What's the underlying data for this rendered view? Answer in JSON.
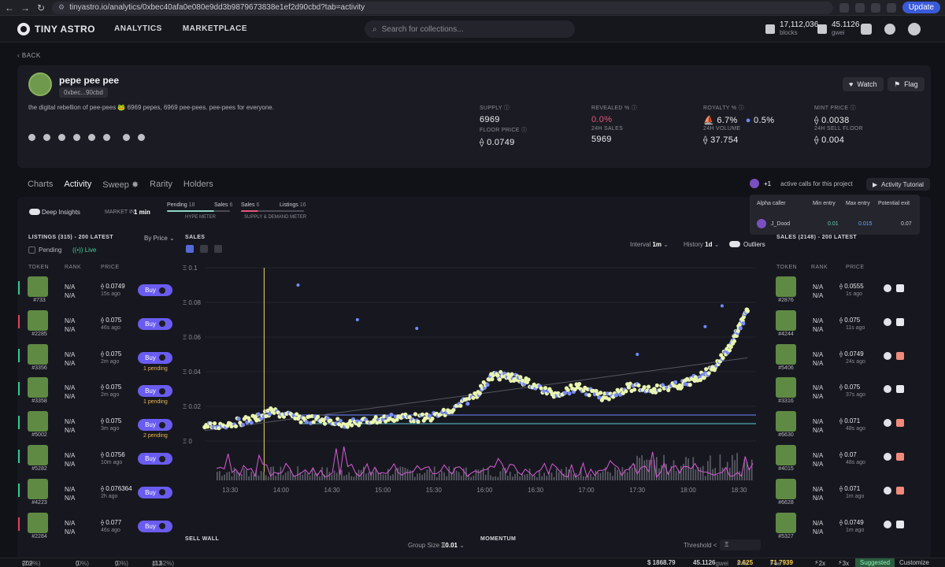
{
  "browser": {
    "url": "tinyastro.io/analytics/0xbec40afa0e080e9dd3b9879673838e1ef2d90cbd?tab=activity",
    "update_label": "Update"
  },
  "header": {
    "brand": "TINY ASTRO",
    "nav": [
      "ANALYTICS",
      "MARKETPLACE"
    ],
    "search_placeholder": "Search for collections...",
    "blocks_value": "17,112,036",
    "blocks_label": "blocks",
    "gas_value": "45.1126",
    "gas_label": "gwei"
  },
  "back_label": "‹ BACK",
  "project": {
    "name": "pepe pee pee",
    "address": "0xbec...90cbd",
    "description": "the digital rebellion of pee-pees 🐸 6969 pepes, 6969 pee-pees. pee-pees for everyone.",
    "watch_label": "Watch",
    "flag_label": "Flag",
    "stats": {
      "supply_label": "SUPPLY",
      "supply": "6969",
      "revealed_label": "REVEALED %",
      "revealed": "0.0%",
      "royalty_label": "ROYALTY %",
      "royalty_a": "6.7%",
      "royalty_b": "0.5%",
      "mint_label": "MINT PRICE",
      "mint": "0.0038",
      "floor_label": "FLOOR PRICE",
      "floor": "0.0749",
      "sales24_label": "24H SALES",
      "sales24": "5969",
      "volume24_label": "24H VOLUME",
      "volume24": "37.754",
      "sellfloor_label": "24H SELL FLOOR",
      "sellfloor": "0.004"
    }
  },
  "tabs": [
    "Charts",
    "Activity",
    "Sweep ✸",
    "Rarity",
    "Holders"
  ],
  "calls": {
    "count": "+1",
    "text": "active calls for this project",
    "tutorial": "Activity Tutorial"
  },
  "alpha": {
    "headers": [
      "Alpha caller",
      "Min entry",
      "Max entry",
      "Potential exit"
    ],
    "row": {
      "caller": "J_Dood",
      "min": "0.01",
      "max": "0.015",
      "exit": "0.07"
    }
  },
  "insights": {
    "deep_label": "Deep Insights",
    "market_label": "MARKET IN",
    "market_value": "1 min",
    "pending_label": "Pending",
    "pending_value": "18",
    "sales_label": "Sales",
    "sales_value": "6",
    "hype_label": "HYPE METER",
    "sd_sales_label": "Sales",
    "sd_sales_value": "6",
    "listings_label": "Listings",
    "listings_value": "16",
    "sd_label": "SUPPLY & DEMAND METER"
  },
  "listings": {
    "title": "LISTINGS (315) - 200 LATEST",
    "sort": "By Price",
    "pending_label": "Pending",
    "live_label": "Live",
    "columns": [
      "TOKEN",
      "RANK",
      "PRICE"
    ],
    "buy_label": "Buy",
    "rows": [
      {
        "id": "#733",
        "rank": "N/A",
        "rank2": "N/A",
        "price": "0.0749",
        "ago": "15s ago",
        "pending": "",
        "bar": "#2ecc8f"
      },
      {
        "id": "#2285",
        "rank": "N/A",
        "rank2": "N/A",
        "price": "0.075",
        "ago": "46s ago",
        "pending": "",
        "bar": "#e0425c"
      },
      {
        "id": "#3356",
        "rank": "N/A",
        "rank2": "N/A",
        "price": "0.075",
        "ago": "2m ago",
        "pending": "1 pending",
        "bar": "#2ecc8f"
      },
      {
        "id": "#3358",
        "rank": "N/A",
        "rank2": "N/A",
        "price": "0.075",
        "ago": "2m ago",
        "pending": "1 pending",
        "bar": "#2ecc8f"
      },
      {
        "id": "#5002",
        "rank": "N/A",
        "rank2": "N/A",
        "price": "0.075",
        "ago": "3m ago",
        "pending": "2 pending",
        "bar": "#2ecc8f"
      },
      {
        "id": "#5282",
        "rank": "N/A",
        "rank2": "N/A",
        "price": "0.0756",
        "ago": "10m ago",
        "pending": "",
        "bar": "#2ecc8f"
      },
      {
        "id": "#4223",
        "rank": "N/A",
        "rank2": "N/A",
        "price": "0.076364",
        "ago": "2h ago",
        "pending": "",
        "bar": "#2ecc8f"
      },
      {
        "id": "#2284",
        "rank": "N/A",
        "rank2": "N/A",
        "price": "0.077",
        "ago": "46s ago",
        "pending": "",
        "bar": "#e0425c"
      }
    ]
  },
  "sales_chart": {
    "title": "SALES",
    "interval_label": "Interval",
    "interval": "1m",
    "history_label": "History",
    "history": "1d",
    "outliers_label": "Outliers"
  },
  "chart_data": {
    "type": "scatter",
    "y_ticks": [
      "Ξ 0.1",
      "Ξ 0.08",
      "Ξ 0.06",
      "Ξ 0.04",
      "Ξ 0.02",
      "Ξ 0"
    ],
    "x_ticks": [
      "13:30",
      "14:00",
      "14:30",
      "15:00",
      "15:30",
      "16:00",
      "16:30",
      "17:00",
      "17:30",
      "18:00",
      "18:30"
    ],
    "ylim": [
      0,
      0.1
    ],
    "series": [
      {
        "values_time": [
          "13:15",
          "13:30",
          "13:45",
          "13:55",
          "14:10",
          "14:25",
          "14:40",
          "14:55",
          "15:10",
          "15:25",
          "15:40",
          "15:55",
          "16:05",
          "16:15",
          "16:25",
          "16:40",
          "16:55",
          "17:10",
          "17:25",
          "17:40",
          "17:55",
          "18:05",
          "18:15",
          "18:25",
          "18:30",
          "18:35"
        ],
        "values": [
          0.008,
          0.01,
          0.013,
          0.017,
          0.013,
          0.012,
          0.01,
          0.012,
          0.014,
          0.013,
          0.017,
          0.027,
          0.038,
          0.037,
          0.034,
          0.027,
          0.031,
          0.025,
          0.031,
          0.03,
          0.032,
          0.036,
          0.042,
          0.055,
          0.065,
          0.075
        ]
      }
    ],
    "overlay_lines": [
      0.015,
      0.01
    ]
  },
  "sales_list": {
    "title": "SALES (2148) - 200 LATEST",
    "columns": [
      "TOKEN",
      "RANK",
      "PRICE"
    ],
    "rows": [
      {
        "id": "#2876",
        "rank": "N/A",
        "rank2": "N/A",
        "price": "0.0555",
        "ago": "1s ago",
        "m2": "#e8e9ee"
      },
      {
        "id": "#4244",
        "rank": "N/A",
        "rank2": "N/A",
        "price": "0.075",
        "ago": "11s ago",
        "m2": "#e8e9ee"
      },
      {
        "id": "#5406",
        "rank": "N/A",
        "rank2": "N/A",
        "price": "0.0749",
        "ago": "24s ago",
        "m2": "#f08a7a"
      },
      {
        "id": "#3316",
        "rank": "N/A",
        "rank2": "N/A",
        "price": "0.075",
        "ago": "37s ago",
        "m2": "#e8e9ee"
      },
      {
        "id": "#6630",
        "rank": "N/A",
        "rank2": "N/A",
        "price": "0.071",
        "ago": "48s ago",
        "m2": "#f08a7a"
      },
      {
        "id": "#4015",
        "rank": "N/A",
        "rank2": "N/A",
        "price": "0.07",
        "ago": "48s ago",
        "m2": "#f08a7a"
      },
      {
        "id": "#6628",
        "rank": "N/A",
        "rank2": "N/A",
        "price": "0.071",
        "ago": "1m ago",
        "m2": "#f08a7a"
      },
      {
        "id": "#5327",
        "rank": "N/A",
        "rank2": "N/A",
        "price": "0.0749",
        "ago": "1m ago",
        "m2": "#e8e9ee"
      }
    ]
  },
  "bottom": {
    "sell_wall": "SELL WALL",
    "group_size_label": "Group Size",
    "group_size": "Ξ0.01",
    "momentum": "MOMENTUM",
    "threshold_label": "Threshold <",
    "threshold": "Ξ"
  },
  "statusbar": {
    "a": "202",
    "a_pct": "(2.9%)",
    "b": "0",
    "b_pct": "(0%)",
    "c": "0",
    "c_pct": "(0%)",
    "d": "113",
    "d_pct": "(1.62%)",
    "eth_price": "$ 1868.79",
    "gwei": "45.1126",
    "gwei_unit": "gwei",
    "prio_label": "Prio",
    "prio": "2.625",
    "fee_label": "Fee",
    "fee": "71.7939",
    "mult1": "2x",
    "mult2": "3x",
    "suggested": "Suggested",
    "customize": "Customize"
  }
}
